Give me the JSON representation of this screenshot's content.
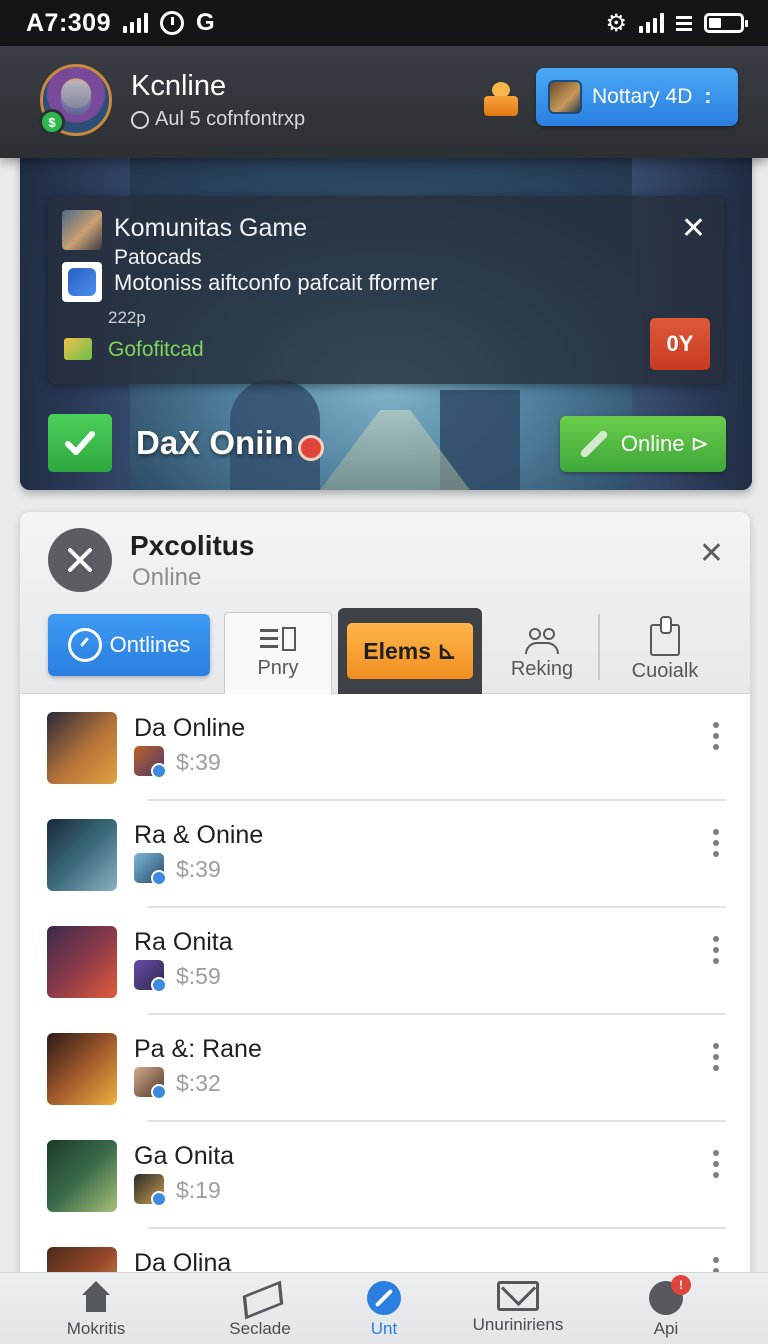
{
  "status_bar": {
    "time": "A7:309",
    "g_label": "G"
  },
  "header": {
    "title": "Kcnline",
    "subtitle": "Aul 5 cofnfontrxp",
    "notify_label": "Nottary 4D",
    "notify_more": ":"
  },
  "banner": {
    "card": {
      "title": "Komunitas Game",
      "line1": "Patocads",
      "line2": "Motoniss aiftconfo pafcait fformer",
      "small": "222p",
      "green_text": "Gofofitcad",
      "badge": "0Y"
    },
    "title": "DaX Oniin",
    "online_button": "Online ⊳"
  },
  "panel": {
    "title": "Pxcolitus",
    "subtitle": "Online",
    "tabs": [
      {
        "label": "Ontlines"
      },
      {
        "label": "Pnry"
      },
      {
        "label": "Elems ⊾"
      },
      {
        "label": "Reking"
      },
      {
        "label": "Cuoialk"
      }
    ],
    "items": [
      {
        "name": "Da Online",
        "price": "$:39",
        "icon": "game-hero-icon",
        "color": "#b8743a"
      },
      {
        "name": "Ra & Onine",
        "price": "$:39",
        "icon": "game-soldier-icon",
        "color": "#3a6a7a"
      },
      {
        "name": "Ra Onita",
        "price": "$:59",
        "icon": "game-warrior-icon",
        "color": "#8a3a4a"
      },
      {
        "name": "Pa &: Rane",
        "price": "$:32",
        "icon": "game-mech-icon",
        "color": "#a0582a"
      },
      {
        "name": "Ga Onita",
        "price": "$:19",
        "icon": "game-knight-icon",
        "color": "#3a6a4a"
      },
      {
        "name": "Da Olina",
        "price": "",
        "icon": "game-orc-icon",
        "color": "#9a4a2a"
      }
    ]
  },
  "bottom_nav": [
    {
      "label": "Mokritis",
      "icon": "home-icon"
    },
    {
      "label": "Seclade",
      "icon": "send-icon"
    },
    {
      "label": "Unt",
      "icon": "wrench-icon"
    },
    {
      "label": "Unuriniriens",
      "icon": "mail-icon"
    },
    {
      "label": "Api",
      "icon": "gear-icon",
      "badge": "!"
    }
  ]
}
